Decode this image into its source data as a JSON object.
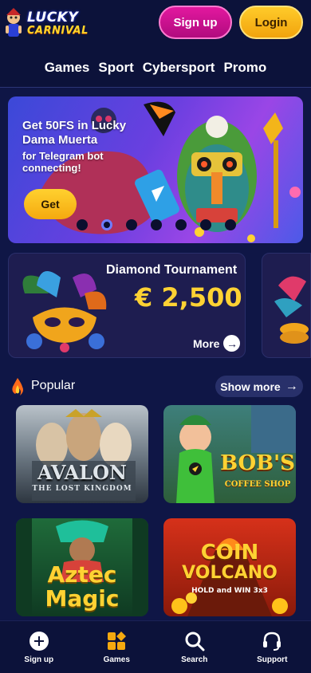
{
  "header": {
    "logo_line1": "LUCKY",
    "logo_line2": "CARNIVAL",
    "signup_label": "Sign up",
    "login_label": "Login"
  },
  "nav": {
    "items": [
      "Games",
      "Sport",
      "Cybersport",
      "Promo"
    ]
  },
  "banner": {
    "title": "Get 50FS in Lucky Dama Muerta",
    "subtitle": "for Telegram bot connecting!",
    "button_label": "Get",
    "dot_count": 7,
    "active_dot": 1
  },
  "tournament": {
    "title": "Diamond Tournament",
    "amount": "€ 2,500",
    "more_label": "More"
  },
  "popular": {
    "title": "Popular",
    "show_more_label": "Show more",
    "games": [
      {
        "title_line1": "AVALON",
        "title_line2": "THE LOST KINGDOM"
      },
      {
        "title_line1": "BOB'S",
        "title_line2": "COFFEE SHOP"
      },
      {
        "title_line1": "Aztec",
        "title_line2": "Magic"
      },
      {
        "title_line1": "COIN",
        "title_line2": "VOLCANO",
        "title_line3": "HOLD and WIN 3x3"
      }
    ]
  },
  "bottom_nav": {
    "items": [
      {
        "label": "Sign up",
        "icon": "plus-circle-icon"
      },
      {
        "label": "Games",
        "icon": "games-grid-icon"
      },
      {
        "label": "Search",
        "icon": "search-icon"
      },
      {
        "label": "Support",
        "icon": "headset-icon"
      }
    ]
  },
  "colors": {
    "background": "#0f1646",
    "accent_pink": "#e2189f",
    "accent_yellow": "#ffcb2a",
    "amount_yellow": "#ffd233"
  }
}
